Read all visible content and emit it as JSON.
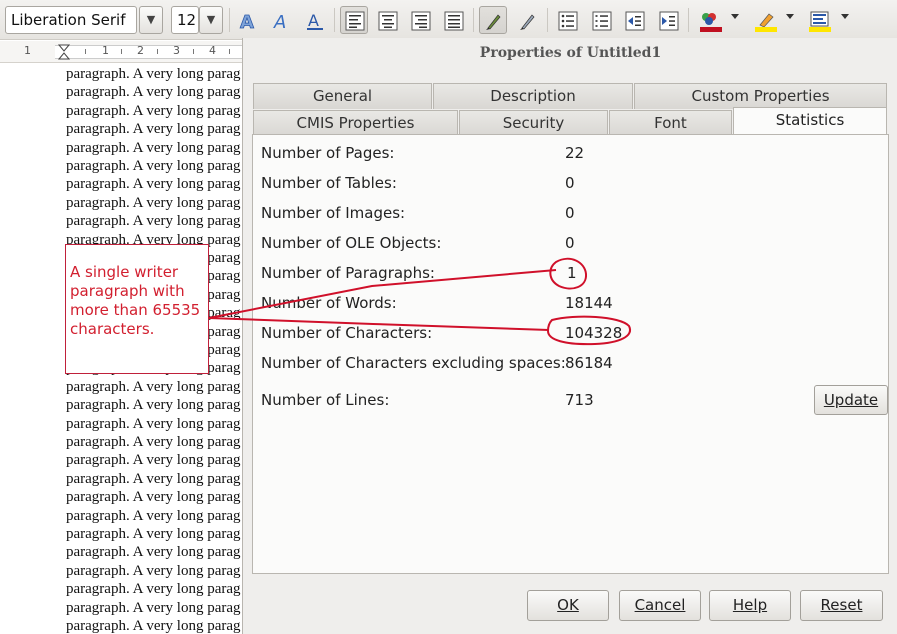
{
  "toolbar": {
    "font_name": "Liberation Serif",
    "font_size": "12",
    "icons": [
      "font-shadow-icon",
      "font-outline-icon",
      "font-color-A-icon",
      "align-left-icon",
      "align-center-icon",
      "align-right-icon",
      "justify-icon",
      "highlight-pen-icon",
      "clear-format-icon",
      "bullet-list-icon",
      "numbered-list-icon",
      "decrease-indent-icon",
      "increase-indent-icon",
      "font-color-icon",
      "highlighting-icon",
      "paragraph-background-icon"
    ],
    "font_color_bar": "#c01020",
    "highlight_bar": "#ffe600",
    "bg_color_bar": "#ffe600"
  },
  "ruler": {
    "numbers": [
      "1",
      "1",
      "2",
      "3",
      "4"
    ]
  },
  "document": {
    "line_text": "paragraph. A very long parag",
    "line_count": 31
  },
  "annotation": {
    "text_lines": [
      "A single writer",
      "paragraph with",
      "more than 65535",
      "characters."
    ],
    "color": "#d21f2f"
  },
  "dialog": {
    "title": "Properties of Untitled1",
    "tabs_row1": [
      "General",
      "Description",
      "Custom Properties"
    ],
    "tabs_row2": [
      "CMIS Properties",
      "Security",
      "Font",
      "Statistics"
    ],
    "active_tab": "Statistics",
    "stats": [
      {
        "label": "Number of Pages:",
        "value": "22"
      },
      {
        "label": "Number of Tables:",
        "value": "0"
      },
      {
        "label": "Number of Images:",
        "value": "0"
      },
      {
        "label": "Number of OLE Objects:",
        "value": "0"
      },
      {
        "label": "Number of Paragraphs:",
        "value": "1"
      },
      {
        "label": "Number of Words:",
        "value": "18144"
      },
      {
        "label": "Number of Characters:",
        "value": "104328"
      },
      {
        "label": "Number of Characters excluding spaces:",
        "value": "86184"
      },
      {
        "label": "Number of Lines:",
        "value": "713"
      }
    ],
    "update_label": "Update",
    "buttons": {
      "ok": "OK",
      "cancel": "Cancel",
      "help": "Help",
      "reset": "Reset"
    }
  }
}
